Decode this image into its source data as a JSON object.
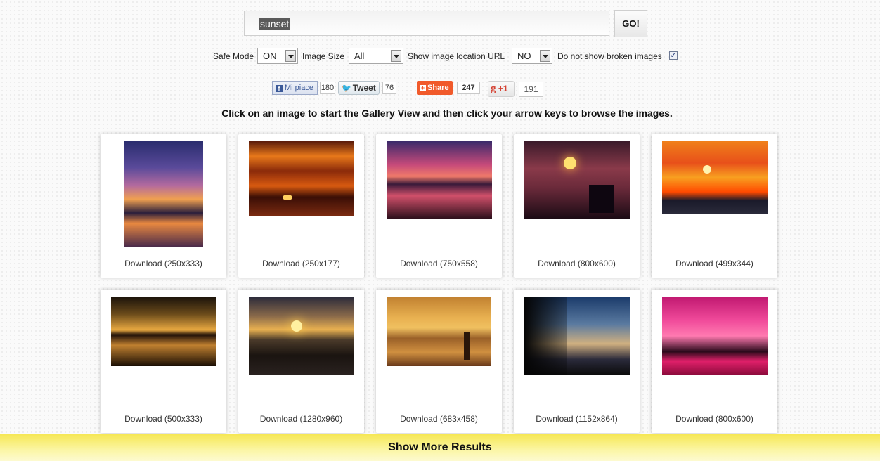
{
  "search": {
    "value": "sunset",
    "go_label": "GO!"
  },
  "options": {
    "safe_mode_label": "Safe Mode",
    "safe_mode_value": "ON",
    "image_size_label": "Image Size",
    "image_size_value": "All",
    "location_label": "Show image location URL",
    "location_value": "NO",
    "broken_label": "Do not show broken images",
    "broken_checked": true
  },
  "social": {
    "facebook_label": "Mi piace",
    "facebook_count": "180",
    "tweet_label": "Tweet",
    "tweet_count": "76",
    "share_label": "Share",
    "share_count": "247",
    "gplus_label": "+1",
    "gplus_count": "191"
  },
  "instructions": "Click on an image to start the Gallery View and then click your arrow keys to browse the images.",
  "results": [
    {
      "label": "Download (250x333)"
    },
    {
      "label": "Download (250x177)"
    },
    {
      "label": "Download (750x558)"
    },
    {
      "label": "Download (800x600)"
    },
    {
      "label": "Download (499x344)"
    },
    {
      "label": "Download (500x333)"
    },
    {
      "label": "Download (1280x960)"
    },
    {
      "label": "Download (683x458)"
    },
    {
      "label": "Download (1152x864)"
    },
    {
      "label": "Download (800x600)"
    }
  ],
  "show_more_label": "Show More Results"
}
